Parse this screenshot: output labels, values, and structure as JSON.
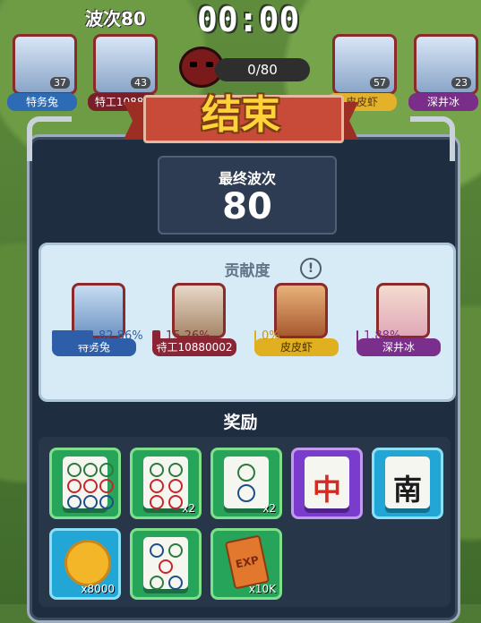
{
  "hud": {
    "wave_label": "波次80",
    "timer": "00:00",
    "kill_progress": "0/80"
  },
  "top_players": [
    {
      "name": "特务兔",
      "level": "37",
      "color": "#2e6bb5"
    },
    {
      "name": "特工10880",
      "level": "43",
      "color": "#7a1e2a"
    },
    {
      "name": "皮皮虾",
      "level": "57",
      "color": "#e3b12a"
    },
    {
      "name": "深井冰",
      "level": "23",
      "color": "#7a2e8a"
    }
  ],
  "result_banner": "结束",
  "final_wave": {
    "label": "最终波次",
    "value": "80"
  },
  "contribution": {
    "title": "贡献度",
    "info_icon": "!",
    "members": [
      {
        "name": "特务兔",
        "percent": "82.86%",
        "fraction": 0.8286,
        "color": "#2e5ea8"
      },
      {
        "name": "特工10880002",
        "percent": "15.26%",
        "fraction": 0.1526,
        "color": "#8a2535"
      },
      {
        "name": "皮皮虾",
        "percent": "0%",
        "fraction": 0.0,
        "color": "#e0b020"
      },
      {
        "name": "深井冰",
        "percent": "1.88%",
        "fraction": 0.0188,
        "color": "#7b2f8c"
      }
    ]
  },
  "rewards": {
    "title": "奖励",
    "items": [
      {
        "icon": "mahjong-9-circles-icon",
        "rarity": "green",
        "qty": ""
      },
      {
        "icon": "mahjong-6-circles-icon",
        "rarity": "green",
        "qty": "x2"
      },
      {
        "icon": "mahjong-2-circles-icon",
        "rarity": "green",
        "qty": "x2"
      },
      {
        "icon": "mahjong-red-dragon-icon",
        "rarity": "purple",
        "glyph": "中",
        "qty": ""
      },
      {
        "icon": "mahjong-south-wind-icon",
        "rarity": "blue",
        "glyph": "南",
        "qty": ""
      },
      {
        "icon": "gold-coin-icon",
        "rarity": "blue",
        "qty": "x8000"
      },
      {
        "icon": "mahjong-5-circles-icon",
        "rarity": "green",
        "qty": ""
      },
      {
        "icon": "exp-book-icon",
        "rarity": "green",
        "glyph": "EXP",
        "qty": "x10K"
      }
    ]
  }
}
